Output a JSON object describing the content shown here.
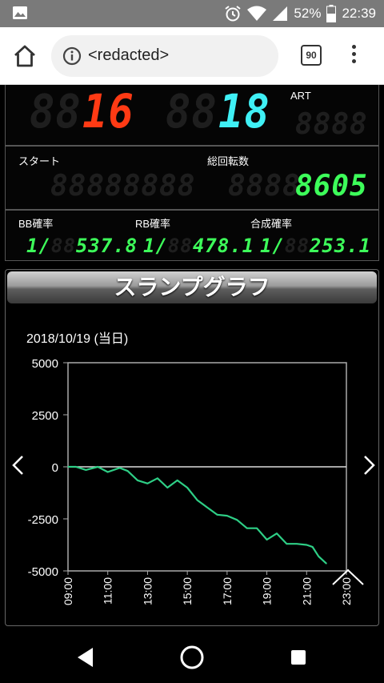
{
  "status_bar": {
    "battery_percent": "52%",
    "time": "22:39"
  },
  "browser": {
    "url": "<redacted>",
    "tab_count": "90"
  },
  "counters": {
    "bb_count": "16",
    "rb_count": "18",
    "bb_ghost": "88",
    "rb_ghost": "88",
    "art_label": "ART",
    "art_ghost": "8888",
    "start_label": "スタート",
    "start_ghost": "88888888",
    "total_spins_label": "総回転数",
    "total_spins_ghost": "8888",
    "total_spins": "8605"
  },
  "rates": {
    "bb_label": "BB確率",
    "rb_label": "RB確率",
    "combined_label": "合成確率",
    "prefix": "1/",
    "bb_rate": "537.8",
    "rb_rate": "478.1",
    "combined_rate": "253.1",
    "ghost": "88"
  },
  "graph": {
    "title": "スランプグラフ",
    "date": "2018/10/19 (当日)"
  },
  "chart_data": {
    "type": "line",
    "title": "",
    "xlabel": "",
    "ylabel": "",
    "x_ticks": [
      "09:00",
      "11:00",
      "13:00",
      "15:00",
      "17:00",
      "19:00",
      "21:00",
      "23:00"
    ],
    "y_ticks": [
      5000,
      2500,
      0,
      -2500,
      -5000
    ],
    "ylim": [
      -5000,
      5000
    ],
    "xlim_hours": [
      9,
      23
    ],
    "grid": false,
    "line_color": "#2ecf86",
    "series": [
      {
        "x": [
          9.0,
          9.4,
          9.9,
          10.5,
          11.0,
          11.6,
          12.0,
          12.5,
          13.0,
          13.5,
          14.0,
          14.5,
          15.0,
          15.5,
          16.0,
          16.5,
          17.0,
          17.5,
          18.0,
          18.5,
          19.0,
          19.5,
          20.0,
          20.5,
          21.0,
          21.3,
          21.6,
          22.0
        ],
        "y": [
          0,
          0,
          -150,
          0,
          -250,
          -50,
          -200,
          -650,
          -800,
          -550,
          -1000,
          -650,
          -1000,
          -1600,
          -1950,
          -2300,
          -2350,
          -2550,
          -2950,
          -2950,
          -3500,
          -3200,
          -3700,
          -3700,
          -3750,
          -3850,
          -4300,
          -4650
        ]
      }
    ]
  },
  "nav_bar": {
    "back_icon": "back-triangle",
    "home_icon": "home-circle",
    "recents_icon": "recents-square"
  }
}
